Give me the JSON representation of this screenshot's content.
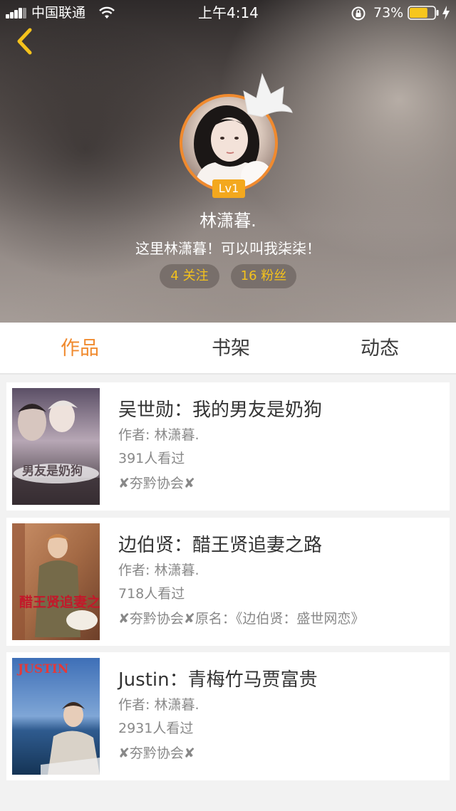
{
  "status_bar": {
    "carrier": "中国联通",
    "time": "上午4:14",
    "battery_percent": "73%",
    "battery_level": 0.73,
    "icons": [
      "signal-icon",
      "wifi-icon",
      "rotation-lock-icon",
      "battery-icon",
      "charging-bolt-icon"
    ]
  },
  "header": {
    "back_icon": "chevron-left-icon",
    "avatar_icon": "crown-icon",
    "level": "Lv1",
    "name": "林潇暮.",
    "bio": "这里林潇暮！可以叫我柒柒！",
    "follow_label": "4 关注",
    "fans_label": "16 粉丝"
  },
  "tabs": [
    {
      "label": "作品",
      "active": true
    },
    {
      "label": "书架",
      "active": false
    },
    {
      "label": "动态",
      "active": false
    }
  ],
  "books": [
    {
      "title": "吴世勋：我的男友是奶狗",
      "author": "作者: 林潇暮.",
      "views": "391人看过",
      "tags": "✘夯黔协会✘",
      "cover_text": "男友是奶狗"
    },
    {
      "title": "边伯贤：醋王贤追妻之路",
      "author": "作者: 林潇暮.",
      "views": "718人看过",
      "tags": "✘夯黔协会✘原名：《边伯贤：盛世网恋》",
      "cover_text": "醋王贤追妻之路"
    },
    {
      "title": "Justin：青梅竹马贾富贵",
      "author": "作者: 林潇暮.",
      "views": "2931人看过",
      "tags": "✘夯黔协会✘",
      "cover_text": "JUSTIN"
    }
  ],
  "colors": {
    "accent": "#f08a2e",
    "badge": "#f3a81e",
    "pill_text": "#f4c21c",
    "back_icon": "#f4c21c"
  }
}
